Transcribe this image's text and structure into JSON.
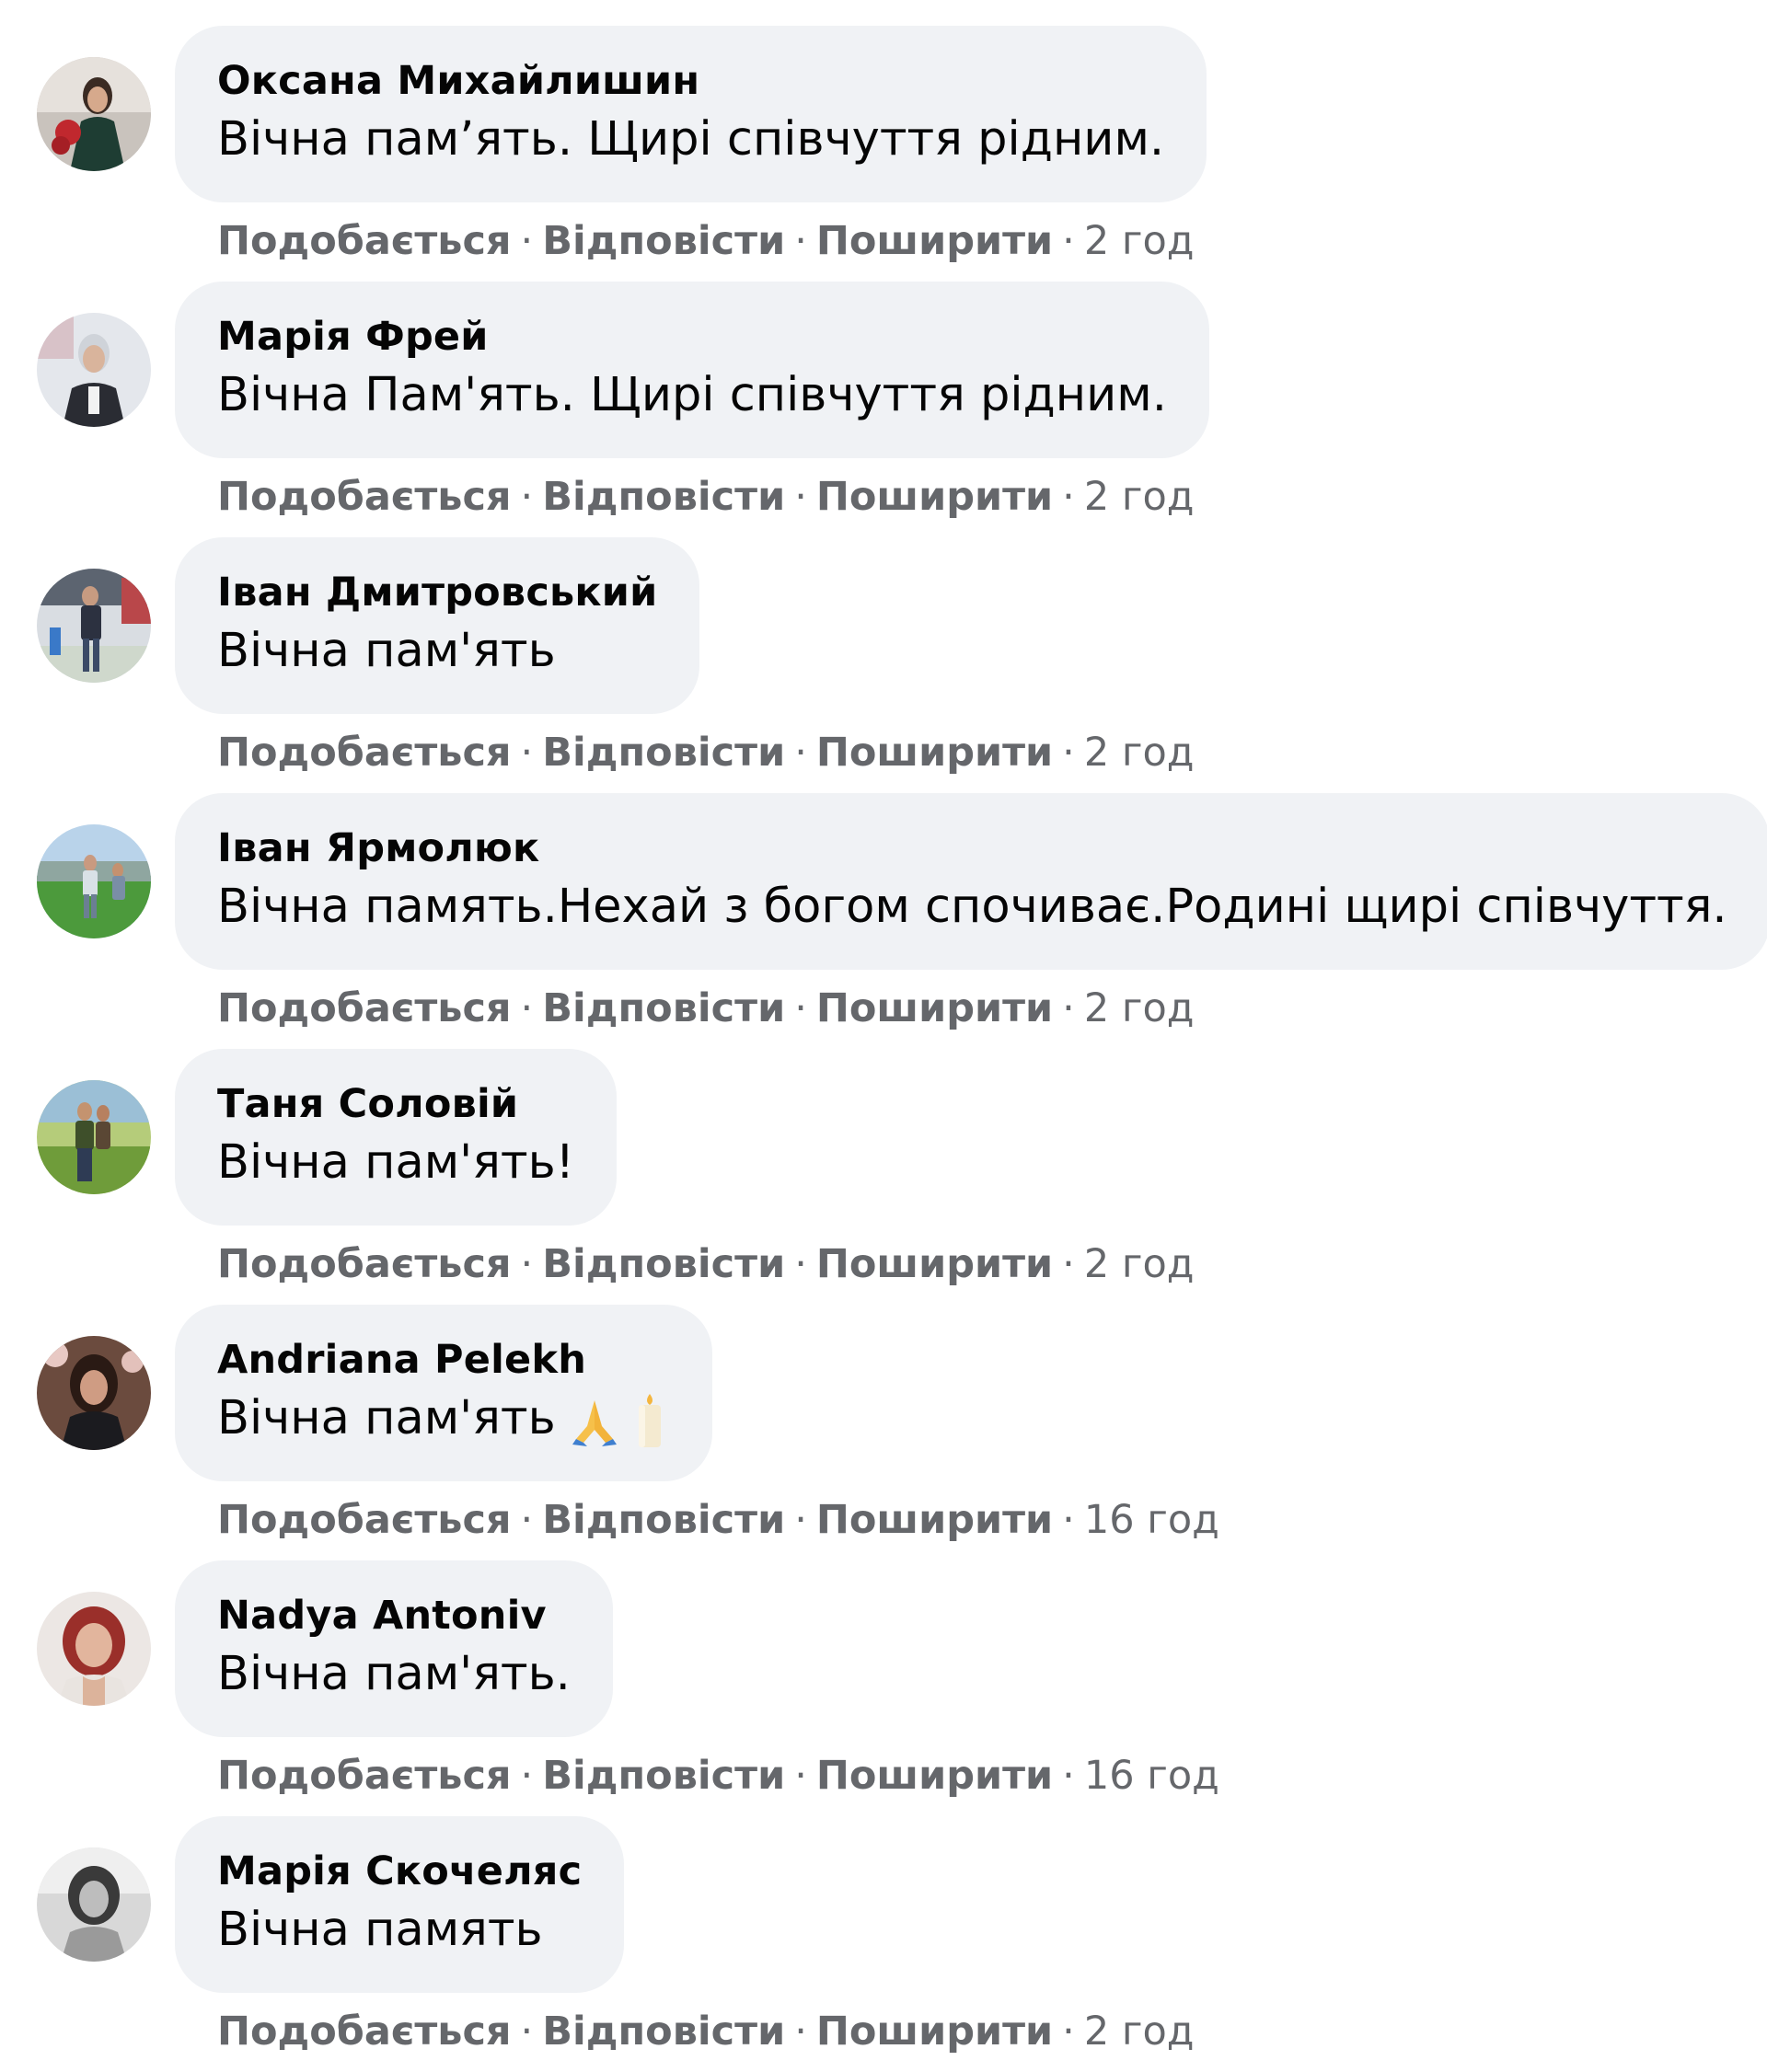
{
  "actions": {
    "like": "Подобається",
    "reply": "Відповісти",
    "share": "Поширити",
    "separator": "·"
  },
  "comments": [
    {
      "author": "Оксана Михайлишин",
      "text": "Вічна пам’ять. Щирі співчуття рідним.",
      "time": "2 год"
    },
    {
      "author": "Марія Фрей",
      "text": "Вічна Пам'ять. Щирі співчуття рідним.",
      "time": "2 год"
    },
    {
      "author": "Іван Дмитровський",
      "text": "Вічна пам'ять",
      "time": "2 год"
    },
    {
      "author": "Іван Ярмолюк",
      "text": "Вічна память.Нехай з богом спочиває.Родині щирі співчуття.",
      "time": "2 год"
    },
    {
      "author": "Таня Соловій",
      "text": "Вічна пам'ять!",
      "time": "2 год"
    },
    {
      "author": "Andriana Pelekh",
      "text": "Вічна пам'ять",
      "emoji": [
        "folded-hands-icon",
        "candle-icon"
      ],
      "time": "16 год"
    },
    {
      "author": "Nadya Antoniv",
      "text": "Вічна пам'ять.",
      "time": "16 год"
    },
    {
      "author": "Марія Скочеляс",
      "text": "Вічна память",
      "time": "2 год"
    }
  ],
  "colors": {
    "bubble": "#f0f2f5",
    "meta_text": "#65676b",
    "text": "#050505"
  }
}
